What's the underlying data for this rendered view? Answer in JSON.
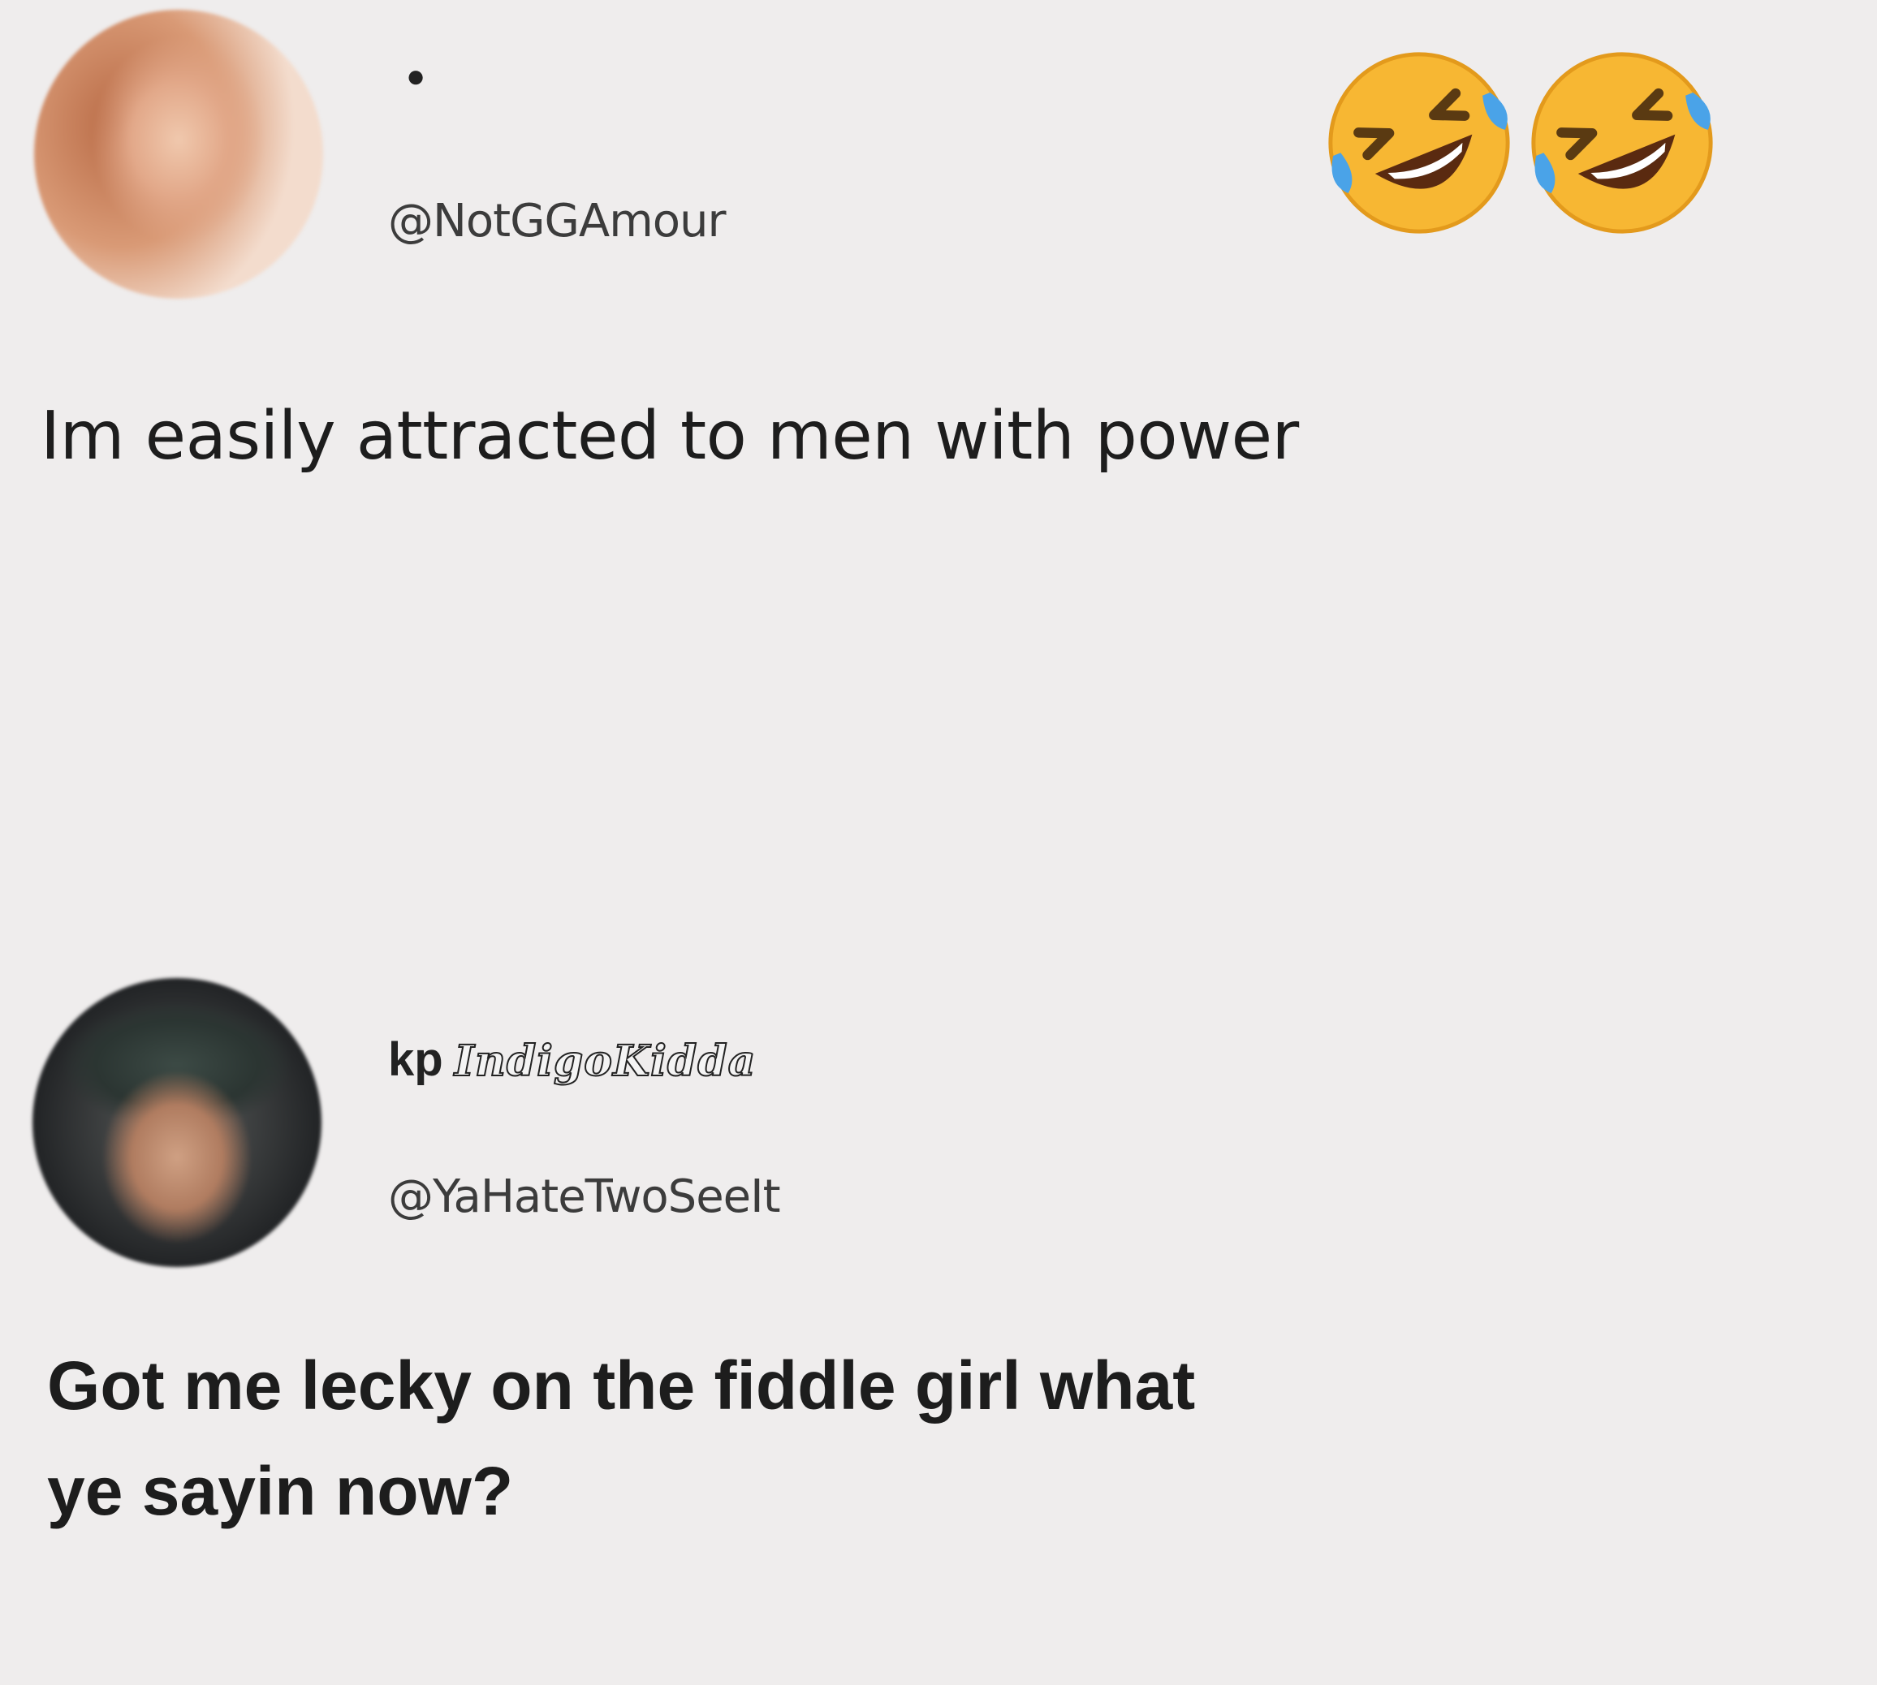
{
  "tweet1": {
    "handle": "@NotGGAmour",
    "text": "Im easily attracted to men with power",
    "avatar_icon": "profile-photo-woman"
  },
  "reaction": {
    "emoji": "rolling-on-the-floor-laughing",
    "count_shown": 2
  },
  "tweet2": {
    "display_name_prefix": "kp",
    "display_name_fancy": "IndigoKidda",
    "handle": "@YaHateTwoSeeIt",
    "text_line1": "Got me lecky on the fiddle girl what",
    "text_line2": "ye sayin now?",
    "avatar_icon": "profile-photo-man-cap"
  },
  "colors": {
    "background": "#efeded",
    "text": "#1d1d1d",
    "handle": "#3c3c3c",
    "emoji_face": "#f7b733",
    "emoji_tear": "#4aa3e8"
  }
}
